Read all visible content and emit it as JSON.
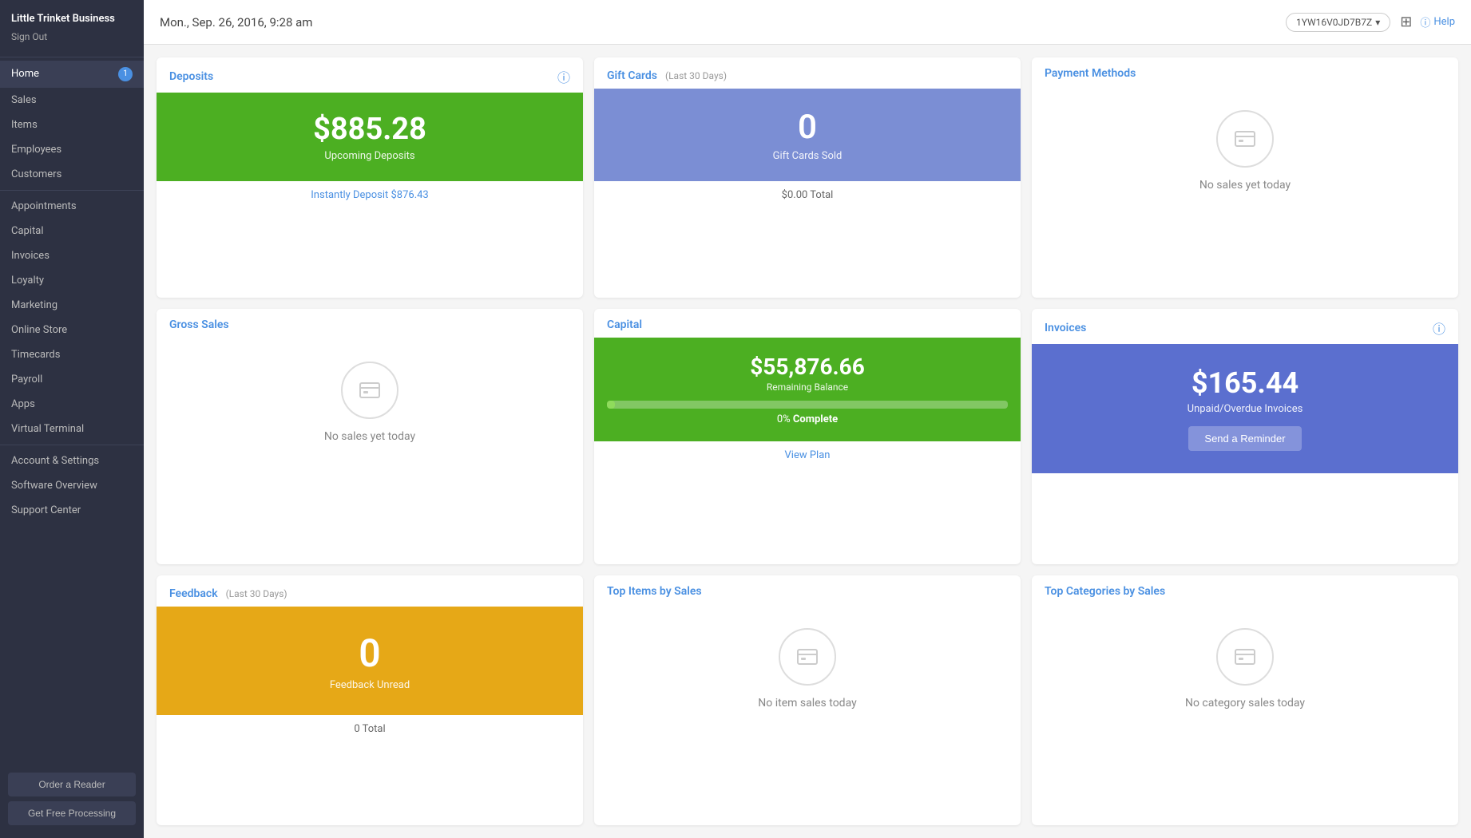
{
  "sidebar": {
    "brand": "Little Trinket Business",
    "signout": "Sign Out",
    "nav_primary": [
      {
        "label": "Home",
        "active": true,
        "badge": "1"
      },
      {
        "label": "Sales",
        "active": false,
        "badge": null
      },
      {
        "label": "Items",
        "active": false,
        "badge": null
      },
      {
        "label": "Employees",
        "active": false,
        "badge": null
      },
      {
        "label": "Customers",
        "active": false,
        "badge": null
      }
    ],
    "nav_secondary": [
      {
        "label": "Appointments"
      },
      {
        "label": "Capital"
      },
      {
        "label": "Invoices"
      },
      {
        "label": "Loyalty"
      },
      {
        "label": "Marketing"
      },
      {
        "label": "Online Store"
      },
      {
        "label": "Timecards"
      },
      {
        "label": "Payroll"
      },
      {
        "label": "Apps"
      },
      {
        "label": "Virtual Terminal"
      }
    ],
    "nav_tertiary": [
      {
        "label": "Account & Settings"
      },
      {
        "label": "Software Overview"
      },
      {
        "label": "Support Center"
      }
    ],
    "order_reader_btn": "Order a Reader",
    "free_processing_btn": "Get Free Processing"
  },
  "header": {
    "date": "Mon., Sep. 26, 2016, 9:28 am",
    "device": "1YW16V0JD7B7Z",
    "help_label": "Help"
  },
  "deposits": {
    "title": "Deposits",
    "amount": "$885.28",
    "label": "Upcoming Deposits",
    "instant_link": "Instantly Deposit $876.43"
  },
  "gift_cards": {
    "title": "Gift Cards",
    "subtitle": "(Last 30 Days)",
    "count": "0",
    "label": "Gift Cards Sold",
    "total": "$0.00 Total"
  },
  "payment_methods": {
    "title": "Payment Methods",
    "no_sales": "No sales yet today"
  },
  "gross_sales": {
    "title": "Gross Sales",
    "no_sales": "No sales yet today"
  },
  "capital": {
    "title": "Capital",
    "amount": "$55,876.66",
    "label": "Remaining Balance",
    "progress_pct": 2,
    "complete_text": "0% Complete",
    "view_plan": "View Plan"
  },
  "invoices": {
    "title": "Invoices",
    "amount": "$165.44",
    "label": "Unpaid/Overdue Invoices",
    "send_reminder": "Send a Reminder"
  },
  "feedback": {
    "title": "Feedback",
    "subtitle": "(Last 30 Days)",
    "count": "0",
    "label": "Feedback Unread",
    "total": "0 Total"
  },
  "top_items": {
    "title": "Top Items by Sales",
    "no_sales": "No item sales today"
  },
  "top_categories": {
    "title": "Top Categories by Sales",
    "no_sales": "No category sales today"
  }
}
